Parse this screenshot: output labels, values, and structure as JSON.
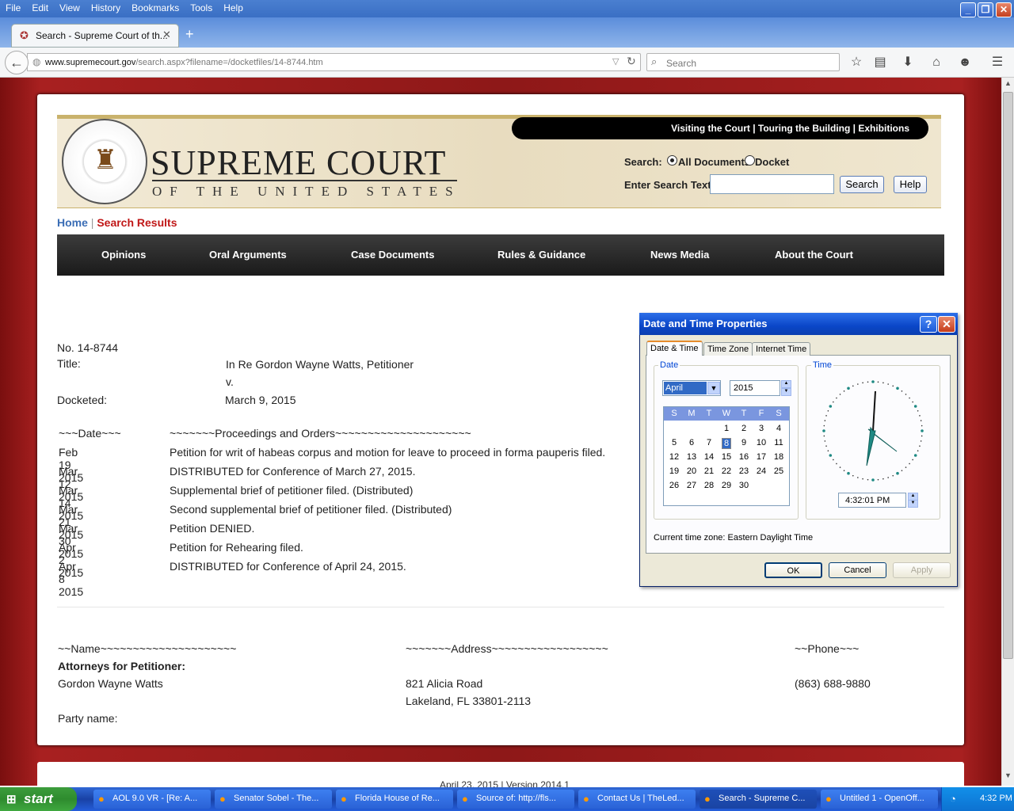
{
  "browser": {
    "menu": [
      "File",
      "Edit",
      "View",
      "History",
      "Bookmarks",
      "Tools",
      "Help"
    ],
    "tab_title": "Search - Supreme Court of th...",
    "url_domain": "www.supremecourt.gov",
    "url_path": "/search.aspx?filename=/docketfiles/14-8744.htm",
    "search_placeholder": "Search"
  },
  "site": {
    "top_links": "Visiting the Court  |  Touring the Building  |  Exhibitions",
    "court_name": "SUPREME COURT",
    "court_sub": "OF THE UNITED STATES",
    "search_label": "Search:",
    "opt_all": "All Documents",
    "opt_docket": "Docket",
    "enter_text_label": "Enter Search Text:",
    "search_btn": "Search",
    "help_btn": "Help",
    "crumb_home": "Home",
    "crumb_sep": "|",
    "crumb_results": "Search Results",
    "nav": [
      "Opinions",
      "Oral Arguments",
      "Case Documents",
      "Rules & Guidance",
      "News Media",
      "About the Court"
    ]
  },
  "docket": {
    "number": "No. 14-8744",
    "title_label": "Title:",
    "title_value": "In Re Gordon Wayne Watts, Petitioner",
    "title_v": "v.",
    "docketed_label": "Docketed:",
    "docketed_value": "March 9, 2015",
    "date_header": "~~~Date~~~",
    "proc_header": "~~~~~~~Proceedings  and  Orders~~~~~~~~~~~~~~~~~~~~~",
    "entries": [
      {
        "date": "Feb 19 2015",
        "text": "Petition for writ of habeas corpus and motion for leave to proceed in forma pauperis filed."
      },
      {
        "date": "Mar 12 2015",
        "text": "DISTRIBUTED for Conference of March 27, 2015."
      },
      {
        "date": "Mar 14 2015",
        "text": "Supplemental brief of petitioner filed. (Distributed)"
      },
      {
        "date": "Mar 21 2015",
        "text": "Second supplemental brief of petitioner filed. (Distributed)"
      },
      {
        "date": "Mar 30 2015",
        "text": "Petition DENIED."
      },
      {
        "date": "Apr 2 2015",
        "text": "Petition for Rehearing filed."
      },
      {
        "date": "Apr 8 2015",
        "text": "DISTRIBUTED for Conference of April 24, 2015."
      }
    ],
    "name_header": "~~Name~~~~~~~~~~~~~~~~~~~~~",
    "addr_header": "~~~~~~~Address~~~~~~~~~~~~~~~~~~",
    "phone_header": "~~Phone~~~",
    "attorneys_label": "Attorneys for Petitioner:",
    "attorney_name": "Gordon Wayne Watts",
    "addr1": "821 Alicia Road",
    "addr2": "Lakeland, FL  33801-2113",
    "phone": "(863) 688-9880",
    "party_label": "Party name:",
    "footer_partial": "April 23, 2015 | Version 2014.1"
  },
  "dialog": {
    "title": "Date and Time Properties",
    "tabs": [
      "Date & Time",
      "Time Zone",
      "Internet Time"
    ],
    "date_group": "Date",
    "time_group": "Time",
    "month": "April",
    "year": "2015",
    "weekdays": [
      "S",
      "M",
      "T",
      "W",
      "T",
      "F",
      "S"
    ],
    "days": [
      [
        "",
        "",
        "",
        "1",
        "2",
        "3",
        "4"
      ],
      [
        "5",
        "6",
        "7",
        "8",
        "9",
        "10",
        "11"
      ],
      [
        "12",
        "13",
        "14",
        "15",
        "16",
        "17",
        "18"
      ],
      [
        "19",
        "20",
        "21",
        "22",
        "23",
        "24",
        "25"
      ],
      [
        "26",
        "27",
        "28",
        "29",
        "30",
        "",
        ""
      ]
    ],
    "selected_day": "8",
    "time_value": "4:32:01 PM",
    "tz_label": "Current time zone:  Eastern Daylight Time",
    "ok": "OK",
    "cancel": "Cancel",
    "apply": "Apply"
  },
  "taskbar": {
    "start": "start",
    "items": [
      "AOL 9.0 VR - [Re: A...",
      "Senator Sobel - The...",
      "Florida House of Re...",
      "Source of: http://fls...",
      "Contact Us | TheLed...",
      "Search - Supreme C...",
      "Untitled 1 - OpenOff..."
    ],
    "clock": "4:32 PM"
  }
}
